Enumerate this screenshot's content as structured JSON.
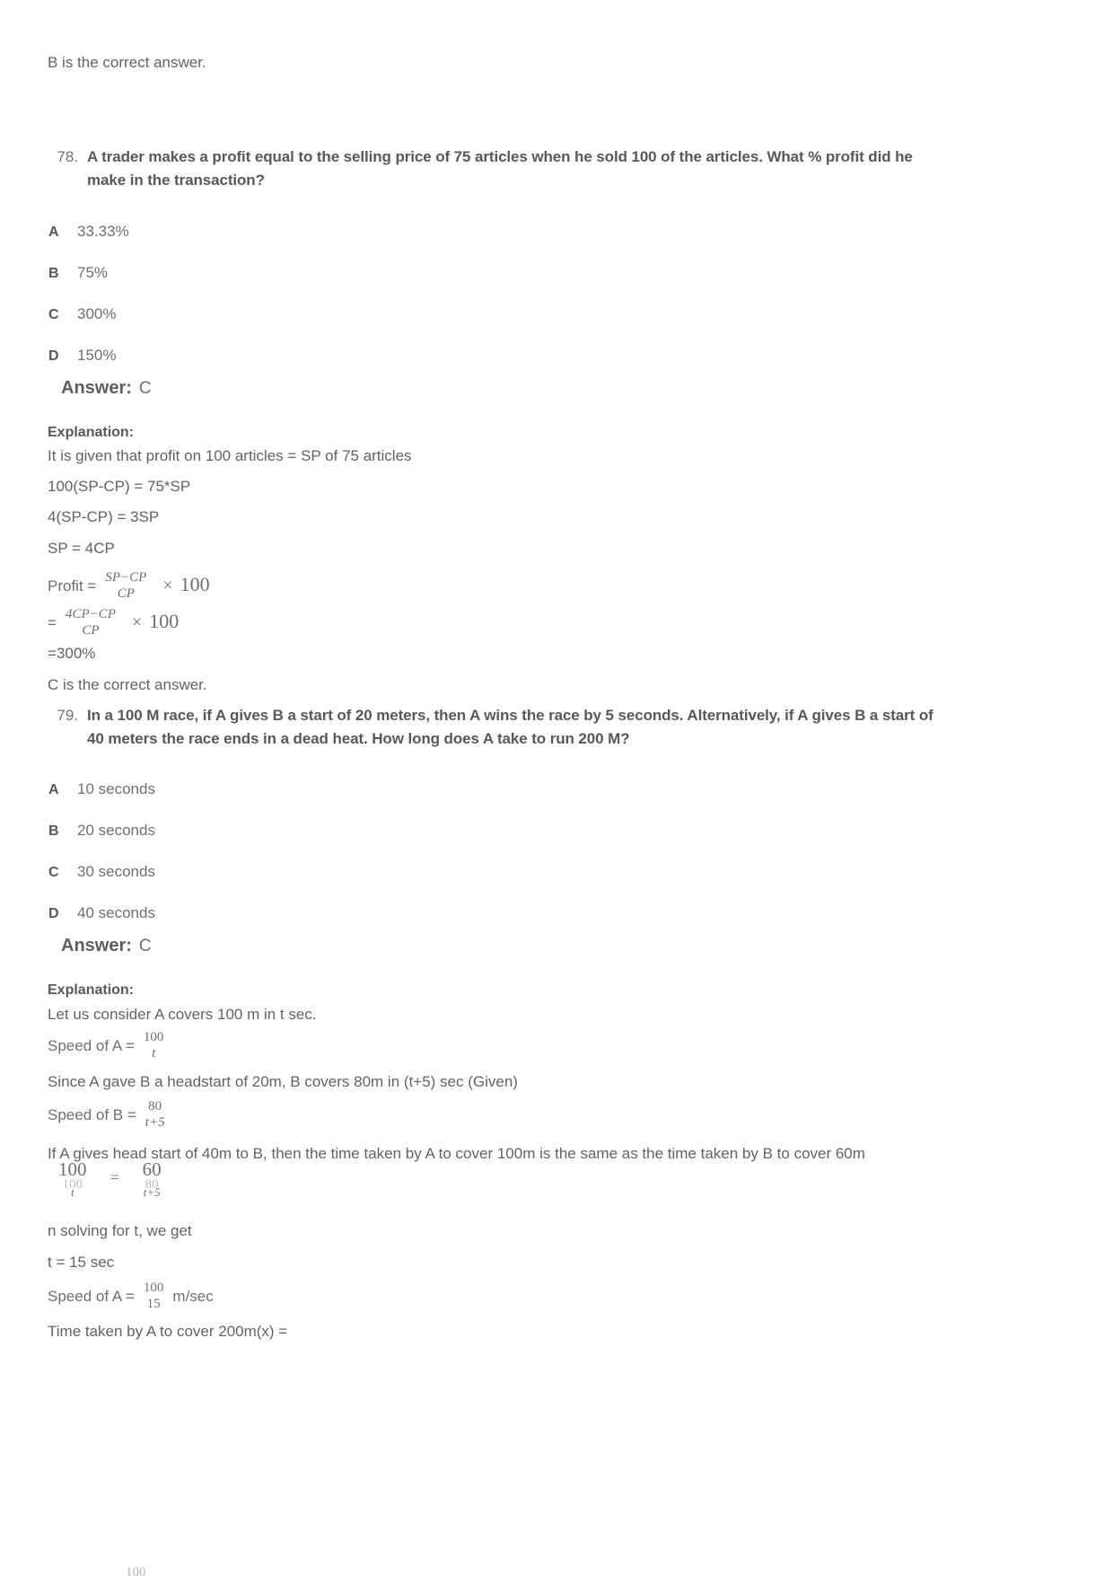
{
  "document": {
    "top_note": "B is the correct answer.",
    "questions": [
      {
        "number": "78.",
        "text": "A trader makes a profit equal to the selling price of 75 articles when he sold 100 of the articles. What % profit did he make in the transaction?",
        "options": [
          {
            "letter": "A",
            "value": "33.33%"
          },
          {
            "letter": "B",
            "value": "75%"
          },
          {
            "letter": "C",
            "value": "300%"
          },
          {
            "letter": "D",
            "value": "150%"
          }
        ],
        "answer_label": "Answer:",
        "answer_value": "C",
        "explanation_label": "Explanation:",
        "explanation_lines": [
          "It is given that profit on 100 articles = SP of 75 articles",
          "100(SP-CP) = 75*SP",
          "4(SP-CP) = 3SP",
          "SP = 4CP"
        ],
        "formula_profit": {
          "lead": "Profit =",
          "numerator": "SP−CP",
          "denominator": "CP",
          "times": "×",
          "multiplier": "100"
        },
        "formula_substituted": {
          "lead": "=",
          "numerator": "4CP−CP",
          "denominator": "CP",
          "times": "×",
          "multiplier": "100"
        },
        "result_line": "=300%",
        "closing_line": "C is the correct answer."
      },
      {
        "number": "79.",
        "text": "In a 100 M race, if A gives B a start of 20 meters, then A wins the race by 5 seconds. Alternatively, if A gives B a start of 40 meters the race ends in a dead heat. How long does A take to run 200 M?",
        "options": [
          {
            "letter": "A",
            "value": "10 seconds"
          },
          {
            "letter": "B",
            "value": "20 seconds"
          },
          {
            "letter": "C",
            "value": "30 seconds"
          },
          {
            "letter": "D",
            "value": "40 seconds"
          }
        ],
        "answer_label": "Answer:",
        "answer_value": "C",
        "explanation_label": "Explanation:",
        "line_consider": "Let us consider A covers 100 m in t sec.",
        "speed_of_a": {
          "lead": "Speed of A =",
          "numerator": "100",
          "denominator": "t"
        },
        "line_headstart": "Since A gave B a headstart of 20m, B covers 80m in (t+5) sec (Given)",
        "speed_of_b": {
          "lead": "Speed of B =",
          "numerator": "80",
          "denominator": "t+5"
        },
        "line_if_head_start": "If A gives head start of 40m to B, then the time taken by A to cover 100m is the same as the time taken by B to cover 60m",
        "equation": {
          "left": {
            "numerator": "100",
            "denominator": "t",
            "ghost_num": "100"
          },
          "equals": "=",
          "right": {
            "numerator": "60",
            "denominator": "t+5",
            "ghost_num": "80"
          }
        },
        "line_solving": "n solving for t, we get",
        "line_t_value": "t =  15 sec",
        "speed_of_a_value": {
          "lead": "Speed of A =",
          "numerator": "100",
          "denominator": "15",
          "suffix": "m/sec"
        },
        "line_time_taken": "Time taken by A to cover 200m(x) =",
        "cut_off_fraction": {
          "numerator": "100"
        }
      }
    ]
  }
}
